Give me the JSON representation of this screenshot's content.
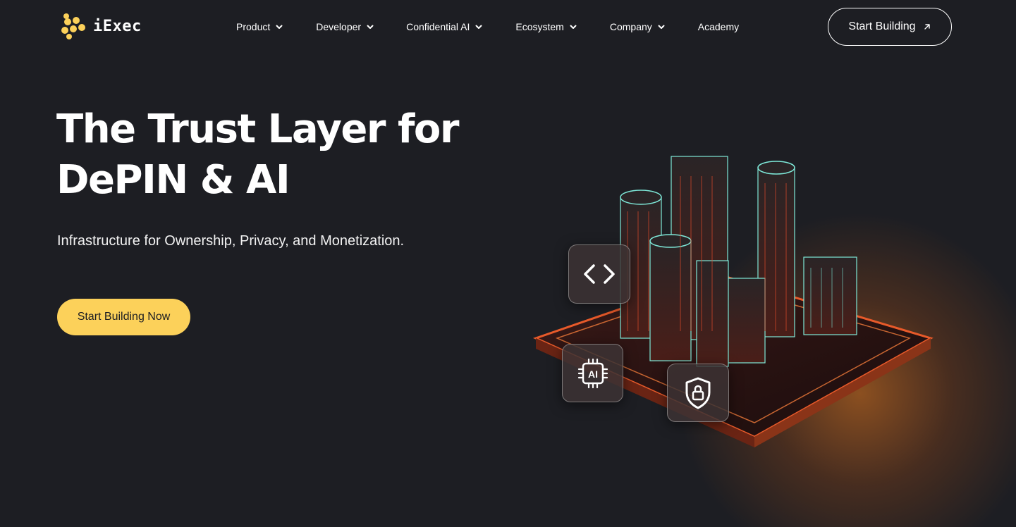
{
  "header": {
    "logo_text": "iExec",
    "nav": [
      {
        "label": "Product",
        "has_dropdown": true
      },
      {
        "label": "Developer",
        "has_dropdown": true
      },
      {
        "label": "Confidential AI",
        "has_dropdown": true
      },
      {
        "label": "Ecosystem",
        "has_dropdown": true
      },
      {
        "label": "Company",
        "has_dropdown": true
      },
      {
        "label": "Academy",
        "has_dropdown": false
      }
    ],
    "cta_label": "Start Building",
    "cta_icon": "arrow-up-right-icon"
  },
  "hero": {
    "title_line1": "The Trust Layer for",
    "title_line2": "DePIN & AI",
    "subtitle": "Infrastructure for Ownership, Privacy, and Monetization.",
    "cta_label": "Start Building Now"
  },
  "illustration": {
    "badges": [
      {
        "name": "code-icon"
      },
      {
        "name": "ai-chip-icon",
        "label": "AI"
      },
      {
        "name": "shield-lock-icon"
      }
    ]
  },
  "colors": {
    "background": "#1d1e23",
    "accent_yellow": "#fcd15a",
    "glow_orange": "#e6781e",
    "building_cyan": "#7ee8d8",
    "building_red": "#e04a2a"
  }
}
